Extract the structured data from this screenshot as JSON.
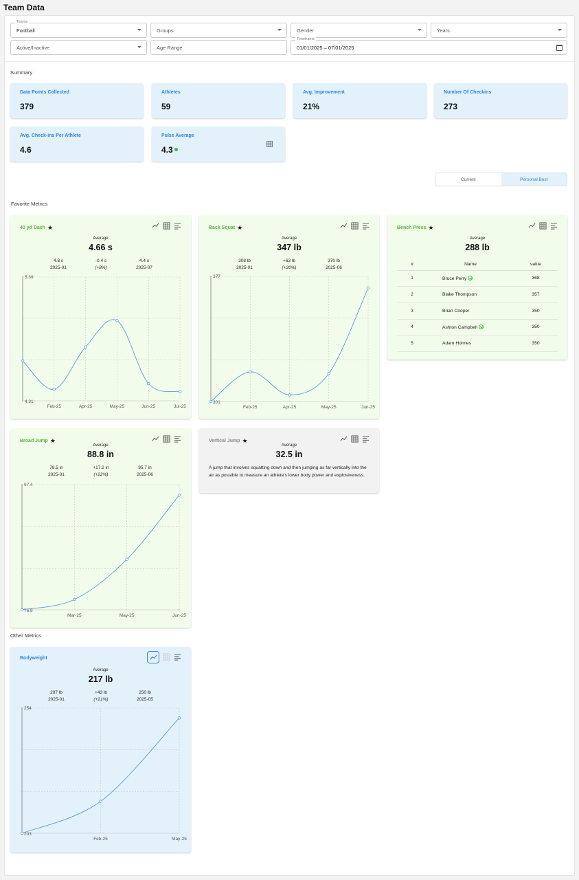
{
  "page": {
    "title": "Team Data"
  },
  "filters": {
    "teams_label": "Teams",
    "teams_value": "Football",
    "groups_placeholder": "Groups",
    "gender_placeholder": "Gender",
    "years_placeholder": "Years",
    "active_placeholder": "Active/Inactive",
    "age_range_placeholder": "Age Range",
    "timeframe_label": "Timeframe",
    "timeframe_value": "01/01/2025 – 07/01/2025"
  },
  "summary": {
    "label": "Summary",
    "cards": [
      {
        "title": "Data Points Collected",
        "value": "379"
      },
      {
        "title": "Athletes",
        "value": "59"
      },
      {
        "title": "Avg. Improvement",
        "value": "21%"
      },
      {
        "title": "Number Of Checkins",
        "value": "273"
      },
      {
        "title": "Avg. Check-ins Per Athlete",
        "value": "4.6"
      },
      {
        "title": "Pulse Average",
        "value": "4.3"
      }
    ],
    "pulse_status_color": "#3db83d"
  },
  "view_toggle": {
    "current": "Current",
    "personal_best": "Personal Best",
    "selected": "Personal Best"
  },
  "favorite_metrics": {
    "label": "Favorite Metrics",
    "dash40": {
      "title": "40 yd Dash",
      "avg_label": "Average",
      "avg": "4.66 s",
      "first_value": "4.8 s",
      "first_period": "2025-01",
      "change": "-0.4 s",
      "change_pct": "(+8%)",
      "last_value": "4.4 s",
      "last_period": "2025-07"
    },
    "back_squat": {
      "title": "Back Squat",
      "avg_label": "Average",
      "avg": "347 lb",
      "first_value": "308 lb",
      "first_period": "2025-01",
      "change": "+63 lb",
      "change_pct": "(+20%)",
      "last_value": "370 lb",
      "last_period": "2025-06"
    },
    "bench_press": {
      "title": "Bench Press",
      "avg_label": "Average",
      "avg": "288 lb",
      "table_headers": [
        "#",
        "Name",
        "value"
      ],
      "rows": [
        {
          "rank": "1",
          "name": "Bruce Perry",
          "value": "368",
          "verified": true
        },
        {
          "rank": "2",
          "name": "Blake Thompson",
          "value": "357",
          "verified": false
        },
        {
          "rank": "3",
          "name": "Brian Cooper",
          "value": "350",
          "verified": false
        },
        {
          "rank": "4",
          "name": "Ashton Campbell",
          "value": "350",
          "verified": true
        },
        {
          "rank": "5",
          "name": "Adam Holmes",
          "value": "350",
          "verified": false
        }
      ]
    },
    "broad_jump": {
      "title": "Broad Jump",
      "avg_label": "Average",
      "avg": "88.8 in",
      "first_value": "78.5 in",
      "first_period": "2025-01",
      "change": "+17.2 in",
      "change_pct": "(+22%)",
      "last_value": "95.7 in",
      "last_period": "2025-06"
    },
    "vertical_jump": {
      "title": "Vertical Jump",
      "avg_label": "Average",
      "avg": "32.5 in",
      "description": "A jump that involves squatting down and then jumping as far vertically into the air as possible to measure an athlete's lower body power and explosiveness."
    }
  },
  "other_metrics": {
    "label": "Other Metrics",
    "bodyweight": {
      "title": "Bodyweight",
      "avg_label": "Average",
      "avg": "217 lb",
      "first_value": "207 lb",
      "first_period": "2025-01",
      "change": "+43 lb",
      "change_pct": "(+21%)",
      "last_value": "250 lb",
      "last_period": "2025-05"
    }
  },
  "colors": {
    "accent": "#2f86d8",
    "green_title": "#57b43d",
    "line": "#5a9bd8"
  },
  "chart_data": [
    {
      "id": "dash40",
      "type": "line",
      "x": [
        "Jan-25",
        "Feb-25",
        "Apr-25",
        "May-25",
        "Jun-25",
        "Jul-25"
      ],
      "x_ticks": [
        "Feb-25",
        "Apr-25",
        "May-25",
        "Jun-25",
        "Jul-25"
      ],
      "y": [
        4.66,
        4.41,
        4.78,
        5.01,
        4.46,
        4.39
      ],
      "ylim": [
        4.31,
        5.39
      ],
      "y_ticks": [
        "5.39",
        "4.31"
      ],
      "grid": true
    },
    {
      "id": "back_squat",
      "type": "line",
      "x": [
        "Jan-25",
        "Feb-25",
        "Apr-25",
        "May-25",
        "Jun-25"
      ],
      "x_ticks": [
        "Feb-25",
        "Apr-25",
        "May-25",
        "Jun-25"
      ],
      "y": [
        301,
        319,
        305,
        318,
        370
      ],
      "ylim": [
        301,
        377
      ],
      "y_ticks": [
        "377",
        "301"
      ],
      "grid": true
    },
    {
      "id": "broad_jump",
      "type": "line",
      "x": [
        "Jan-25",
        "Mar-25",
        "May-25",
        "Jun-25"
      ],
      "x_ticks": [
        "Mar-25",
        "May-25",
        "Jun-25"
      ],
      "y": [
        76.8,
        78.5,
        85.1,
        95.7
      ],
      "ylim": [
        76.8,
        97.4
      ],
      "y_ticks": [
        "97.4",
        "76.8"
      ],
      "grid": true
    },
    {
      "id": "bodyweight",
      "type": "line",
      "x": [
        "Jan-25",
        "Feb-25",
        "May-25"
      ],
      "x_ticks": [
        "Feb-25",
        "May-25"
      ],
      "y": [
        203,
        216,
        250
      ],
      "ylim": [
        203,
        254
      ],
      "y_ticks": [
        "254",
        "203"
      ],
      "grid": true
    }
  ]
}
